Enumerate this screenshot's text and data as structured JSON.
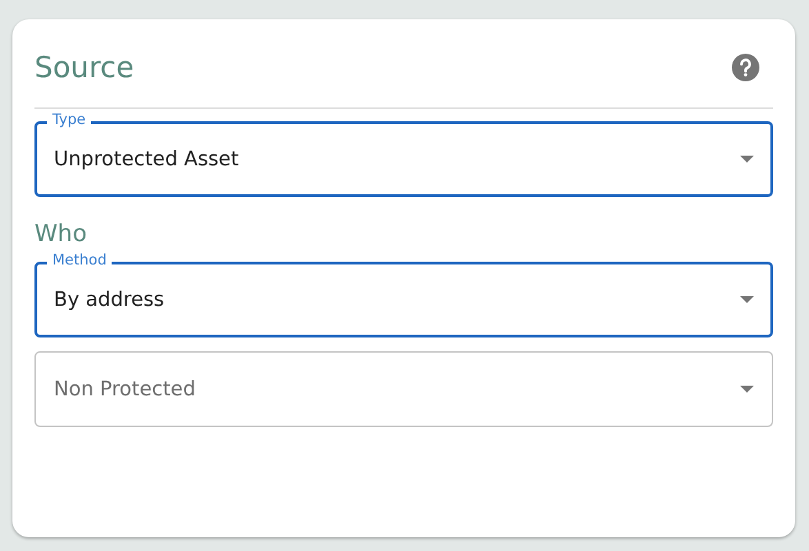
{
  "card": {
    "title": "Source",
    "sections": [
      {
        "fields": [
          {
            "label": "Type",
            "value": "Unprotected Asset",
            "focused": true
          }
        ]
      },
      {
        "heading": "Who",
        "fields": [
          {
            "label": "Method",
            "value": "By address",
            "focused": true
          },
          {
            "placeholder": "Non Protected",
            "focused": false
          }
        ]
      }
    ]
  }
}
